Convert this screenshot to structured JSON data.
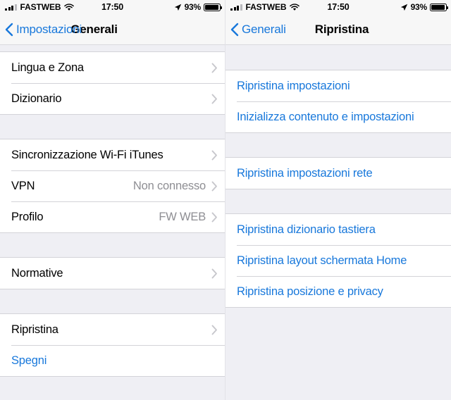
{
  "colors": {
    "accent_blue": "#1878DB",
    "background_gray": "#EFEFF4",
    "row_white": "#FFFFFF",
    "separator": "#D3D3D8",
    "secondary_text": "#8E8E93",
    "navbar_bg": "#F7F7F7"
  },
  "panels": [
    {
      "id": "general-settings",
      "status_bar": {
        "carrier": "FASTWEB",
        "wifi_icon": "wifi-icon",
        "signal_icon": "signal-bars-icon",
        "time": "17:50",
        "location_icon": "location-arrow-icon",
        "battery_percent": "93%",
        "battery_icon": "battery-icon",
        "battery_level": 93
      },
      "nav": {
        "back_icon": "chevron-left-icon",
        "back_label": "Impostazioni",
        "title": "Generali"
      },
      "groups": [
        {
          "rows": [
            {
              "label": "Lingua e Zona",
              "value": "",
              "accessory": "chevron-right-icon",
              "style": "default"
            },
            {
              "label": "Dizionario",
              "value": "",
              "accessory": "chevron-right-icon",
              "style": "default"
            }
          ]
        },
        {
          "rows": [
            {
              "label": "Sincronizzazione Wi-Fi iTunes",
              "value": "",
              "accessory": "chevron-right-icon",
              "style": "default"
            },
            {
              "label": "VPN",
              "value": "Non connesso",
              "accessory": "chevron-right-icon",
              "style": "default"
            },
            {
              "label": "Profilo",
              "value": "FW WEB",
              "accessory": "chevron-right-icon",
              "style": "default"
            }
          ]
        },
        {
          "rows": [
            {
              "label": "Normative",
              "value": "",
              "accessory": "chevron-right-icon",
              "style": "default"
            }
          ]
        },
        {
          "rows": [
            {
              "label": "Ripristina",
              "value": "",
              "accessory": "chevron-right-icon",
              "style": "default"
            },
            {
              "label": "Spegni",
              "value": "",
              "accessory": "none",
              "style": "blue"
            }
          ]
        }
      ]
    },
    {
      "id": "reset-settings",
      "status_bar": {
        "carrier": "FASTWEB",
        "wifi_icon": "wifi-icon",
        "signal_icon": "signal-bars-icon",
        "time": "17:50",
        "location_icon": "location-arrow-icon",
        "battery_percent": "93%",
        "battery_icon": "battery-icon",
        "battery_level": 93
      },
      "nav": {
        "back_icon": "chevron-left-icon",
        "back_label": "Generali",
        "title": "Ripristina"
      },
      "groups": [
        {
          "rows": [
            {
              "label": "Ripristina impostazioni",
              "value": "",
              "accessory": "none",
              "style": "blue"
            },
            {
              "label": "Inizializza contenuto e impostazioni",
              "value": "",
              "accessory": "none",
              "style": "blue"
            }
          ]
        },
        {
          "rows": [
            {
              "label": "Ripristina impostazioni rete",
              "value": "",
              "accessory": "none",
              "style": "blue"
            }
          ]
        },
        {
          "rows": [
            {
              "label": "Ripristina dizionario tastiera",
              "value": "",
              "accessory": "none",
              "style": "blue"
            },
            {
              "label": "Ripristina layout schermata Home",
              "value": "",
              "accessory": "none",
              "style": "blue"
            },
            {
              "label": "Ripristina posizione e privacy",
              "value": "",
              "accessory": "none",
              "style": "blue"
            }
          ]
        }
      ]
    }
  ]
}
